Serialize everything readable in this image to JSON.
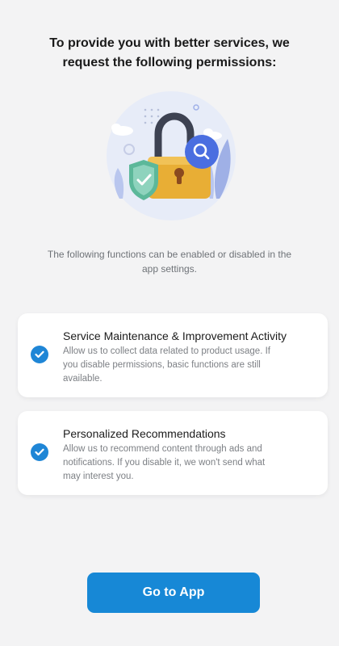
{
  "header": {
    "title_line1": "To provide you with better services, we",
    "title_line2": "request the following permissions:"
  },
  "illustration": {
    "icons": [
      "padlock-icon",
      "shield-check-icon",
      "magnifier-icon",
      "leaf-icon",
      "cloud-icon"
    ]
  },
  "hint": {
    "line1": "The following functions can be enabled or disabled in the",
    "line2": "app settings."
  },
  "permissions": [
    {
      "title": "Service Maintenance & Improvement Activity",
      "desc_line1": "Allow us to collect data related to product usage. If",
      "desc_line2": "you disable permissions, basic functions are still",
      "desc_line3": "available.",
      "checked": true
    },
    {
      "title": "Personalized Recommendations",
      "desc_line1": "Allow us to recommend content through ads and",
      "desc_line2": "notifications. If you disable it, we won't send what",
      "desc_line3": "may interest you.",
      "checked": true
    }
  ],
  "cta": {
    "label": "Go to App"
  },
  "colors": {
    "accent": "#1788d6",
    "check": "#1f86d6",
    "background": "#f3f3f4",
    "lock_body": "#e8ae35",
    "shield": "#5cb89a",
    "magnifier_badge": "#4a6ee0"
  }
}
